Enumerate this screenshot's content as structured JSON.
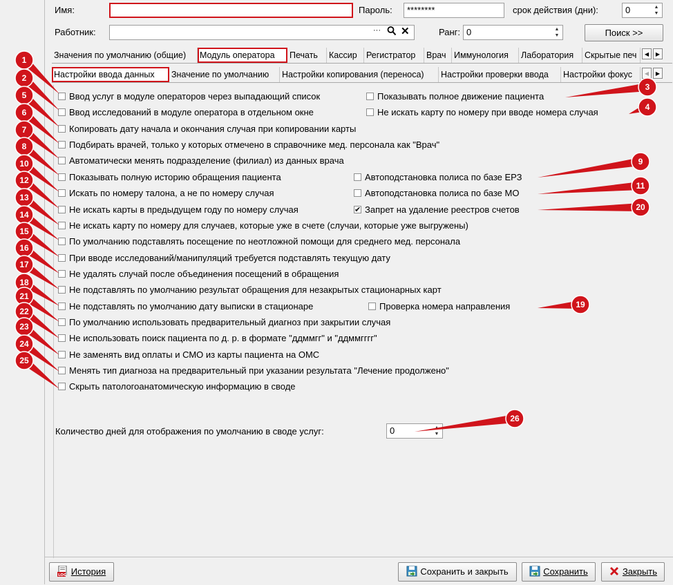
{
  "header": {
    "name_label": "Имя:",
    "name_value": "",
    "password_label": "Пароль:",
    "password_value": "********",
    "validity_label": "срок действия (дни):",
    "validity_value": "0",
    "worker_label": "Работник:",
    "worker_value": "",
    "worker_more": "···",
    "rank_label": "Ранг:",
    "rank_value": "0",
    "search_button": "Поиск  >>"
  },
  "tabs_main": [
    {
      "label": "Значения по умолчанию (общие)",
      "selected": false
    },
    {
      "label": "Модуль оператора",
      "selected": true
    },
    {
      "label": "Печать",
      "selected": false
    },
    {
      "label": "Кассир",
      "selected": false
    },
    {
      "label": "Регистратор",
      "selected": false
    },
    {
      "label": "Врач",
      "selected": false
    },
    {
      "label": "Иммунология",
      "selected": false
    },
    {
      "label": "Лаборатория",
      "selected": false
    },
    {
      "label": "Скрытые печ",
      "selected": false
    }
  ],
  "tabs_sub": [
    {
      "label": "Настройки ввода данных",
      "selected": true
    },
    {
      "label": "Значение по умолчанию",
      "selected": false
    },
    {
      "label": "Настройки копирования (переноса)",
      "selected": false
    },
    {
      "label": "Настройки проверки ввода",
      "selected": false
    },
    {
      "label": "Настройки фокус",
      "selected": false
    }
  ],
  "options_left": [
    {
      "label": "Ввод услуг в модуле операторов через выпадающий список",
      "checked": false
    },
    {
      "label": "Ввод исследований в модуле оператора в отдельном окне",
      "checked": false
    },
    {
      "label": "Копировать дату начала и окончания случая при копировании карты",
      "checked": false
    },
    {
      "label": "Подбирать врачей, только у которых отмечено в справочнике мед. персонала как \"Врач\"",
      "checked": false
    },
    {
      "label": "Автоматически менять подразделение (филиал) из данных врача",
      "checked": false
    },
    {
      "label": "Показывать полную историю обращения пациента",
      "checked": false
    },
    {
      "label": "Искать по номеру талона, а не по номеру случая",
      "checked": false
    },
    {
      "label": "Не искать карты в предыдущем году по номеру случая",
      "checked": false
    },
    {
      "label": "Не искать карту по номеру для случаев, которые уже в счете (случаи, которые уже выгружены)",
      "checked": false
    },
    {
      "label": "По умолчанию подставлять посещение по неотложной помощи для среднего мед. персонала",
      "checked": false
    },
    {
      "label": "При вводе исследований/манипуляций требуется подставлять текущую дату",
      "checked": false
    },
    {
      "label": "Не удалять случай после объединения посещений в обращения",
      "checked": false
    },
    {
      "label": "Не подставлять по умолчанию результат обращения для незакрытых стационарных карт",
      "checked": false
    },
    {
      "label": "Не подставлять по умолчанию дату выписки в стационаре",
      "checked": false
    },
    {
      "label": "По умолчанию использовать предварительный диагноз при закрытии случая",
      "checked": false
    },
    {
      "label": "Не использовать поиск пациента по д. р. в формате \"ддммгг\" и \"ддммгггг\"",
      "checked": false
    },
    {
      "label": "Не заменять вид оплаты и СМО из карты пациента на ОМС",
      "checked": false
    },
    {
      "label": "Менять тип диагноза на предварительный при указании результата \"Лечение продолжено\"",
      "checked": false
    },
    {
      "label": "Скрыть патологоанатомическую информацию в своде",
      "checked": false
    }
  ],
  "options_right": [
    {
      "label": "Показывать полное движение пациента",
      "checked": false
    },
    {
      "label": "Не искать карту по номеру при вводе номера случая",
      "checked": false
    },
    {
      "label": "Автоподстановка полиса по базе ЕРЗ",
      "checked": false
    },
    {
      "label": "Автоподстановка полиса по базе МО",
      "checked": false
    },
    {
      "label": "Запрет на удаление реестров счетов",
      "checked": true
    },
    {
      "label": "Проверка номера направления",
      "checked": false
    }
  ],
  "days_label": "Количество дней для отображения по умолчанию в своде услуг:",
  "days_value": "0",
  "buttons": {
    "history": "История",
    "save_close": "Сохранить и закрыть",
    "save": "Сохранить",
    "close": "Закрыть"
  },
  "markers": [
    "1",
    "2",
    "5",
    "6",
    "7",
    "8",
    "10",
    "12",
    "13",
    "14",
    "15",
    "16",
    "17",
    "18",
    "21",
    "22",
    "23",
    "24",
    "25",
    "3",
    "4",
    "9",
    "11",
    "20",
    "19",
    "26"
  ],
  "colors": {
    "marker": "#d0141b",
    "highlight": "#d0141b"
  }
}
